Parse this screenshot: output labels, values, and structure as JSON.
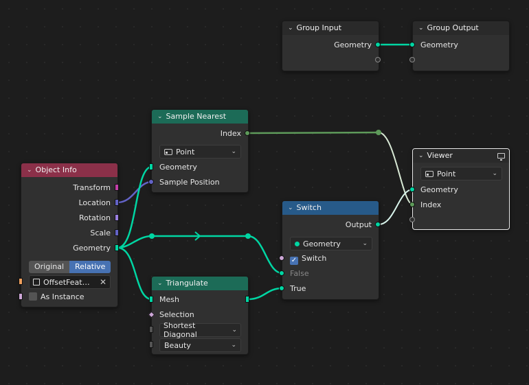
{
  "colors": {
    "geometry_socket": "#00d6a3",
    "integer_socket": "#5e9a5a",
    "vector_socket": "#6363c7",
    "matrix_socket": "#c240a9",
    "boolean_socket": "#cca6d6",
    "object_socket": "#ed9e5c",
    "geometry_header": "#1c6b57",
    "input_header": "#8b3049",
    "converter_header": "#275a89",
    "accent": "#4772b3"
  },
  "group_input": {
    "title": "Group Input",
    "geometry": "Geometry"
  },
  "group_output": {
    "title": "Group Output",
    "geometry": "Geometry"
  },
  "sample_nearest": {
    "title": "Sample Nearest",
    "index": "Index",
    "domain": "Point",
    "geometry": "Geometry",
    "sample_position": "Sample Position"
  },
  "object_info": {
    "title": "Object Info",
    "transform": "Transform",
    "location": "Location",
    "rotation": "Rotation",
    "scale": "Scale",
    "geometry": "Geometry",
    "mode_original": "Original",
    "mode_relative": "Relative",
    "mode_selected": "Relative",
    "object": "OffsetFeat…",
    "as_instance": "As Instance",
    "as_instance_checked": false
  },
  "switch": {
    "title": "Switch",
    "output": "Output",
    "type": "Geometry",
    "switch_label": "Switch",
    "switch_checked": true,
    "false_label": "False",
    "true_label": "True"
  },
  "triangulate": {
    "title": "Triangulate",
    "mesh": "Mesh",
    "selection": "Selection",
    "quad_method": "Shortest Diagonal",
    "ngon_method": "Beauty"
  },
  "viewer": {
    "title": "Viewer",
    "domain": "Point",
    "geometry": "Geometry",
    "index": "Index"
  }
}
